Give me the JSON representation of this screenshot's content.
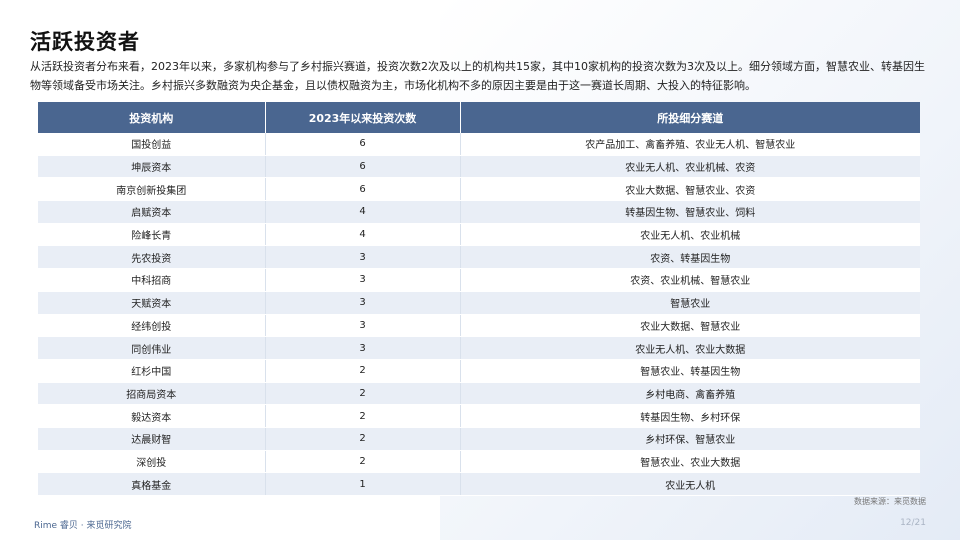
{
  "title": "活跃投资者",
  "summary": "从活跃投资者分布来看，2023年以来，多家机构参与了乡村振兴赛道，投资次数2次及以上的机构共15家，其中10家机构的投资次数为3次及以上。细分领域方面，智慧农业、转基因生物等领域备受市场关注。乡村振兴多数融资为央企基金，且以债权融资为主，市场化机构不多的原因主要是由于这一赛道长周期、大投入的特征影响。",
  "table": {
    "headers": [
      "投资机构",
      "2023年以来投资次数",
      "所投细分赛道"
    ],
    "rows": [
      {
        "institution": "国投创益",
        "count": "6",
        "sectors": "农产品加工、禽畜养殖、农业无人机、智慧农业"
      },
      {
        "institution": "坤辰资本",
        "count": "6",
        "sectors": "农业无人机、农业机械、农资"
      },
      {
        "institution": "南京创新投集团",
        "count": "6",
        "sectors": "农业大数据、智慧农业、农资"
      },
      {
        "institution": "启赋资本",
        "count": "4",
        "sectors": "转基因生物、智慧农业、饲料"
      },
      {
        "institution": "险峰长青",
        "count": "4",
        "sectors": "农业无人机、农业机械"
      },
      {
        "institution": "先农投资",
        "count": "3",
        "sectors": "农资、转基因生物"
      },
      {
        "institution": "中科招商",
        "count": "3",
        "sectors": "农资、农业机械、智慧农业"
      },
      {
        "institution": "天赋资本",
        "count": "3",
        "sectors": "智慧农业"
      },
      {
        "institution": "经纬创投",
        "count": "3",
        "sectors": "农业大数据、智慧农业"
      },
      {
        "institution": "同创伟业",
        "count": "3",
        "sectors": "农业无人机、农业大数据"
      },
      {
        "institution": "红杉中国",
        "count": "2",
        "sectors": "智慧农业、转基因生物"
      },
      {
        "institution": "招商局资本",
        "count": "2",
        "sectors": "乡村电商、禽畜养殖"
      },
      {
        "institution": "毅达资本",
        "count": "2",
        "sectors": "转基因生物、乡村环保"
      },
      {
        "institution": "达晨财智",
        "count": "2",
        "sectors": "乡村环保、智慧农业"
      },
      {
        "institution": "深创投",
        "count": "2",
        "sectors": "智慧农业、农业大数据"
      },
      {
        "institution": "真格基金",
        "count": "1",
        "sectors": "农业无人机"
      }
    ]
  },
  "source": "数据来源：来觅数据",
  "footer_logo": "Rime 睿贝 · 来觅研究院",
  "page": "12/21"
}
